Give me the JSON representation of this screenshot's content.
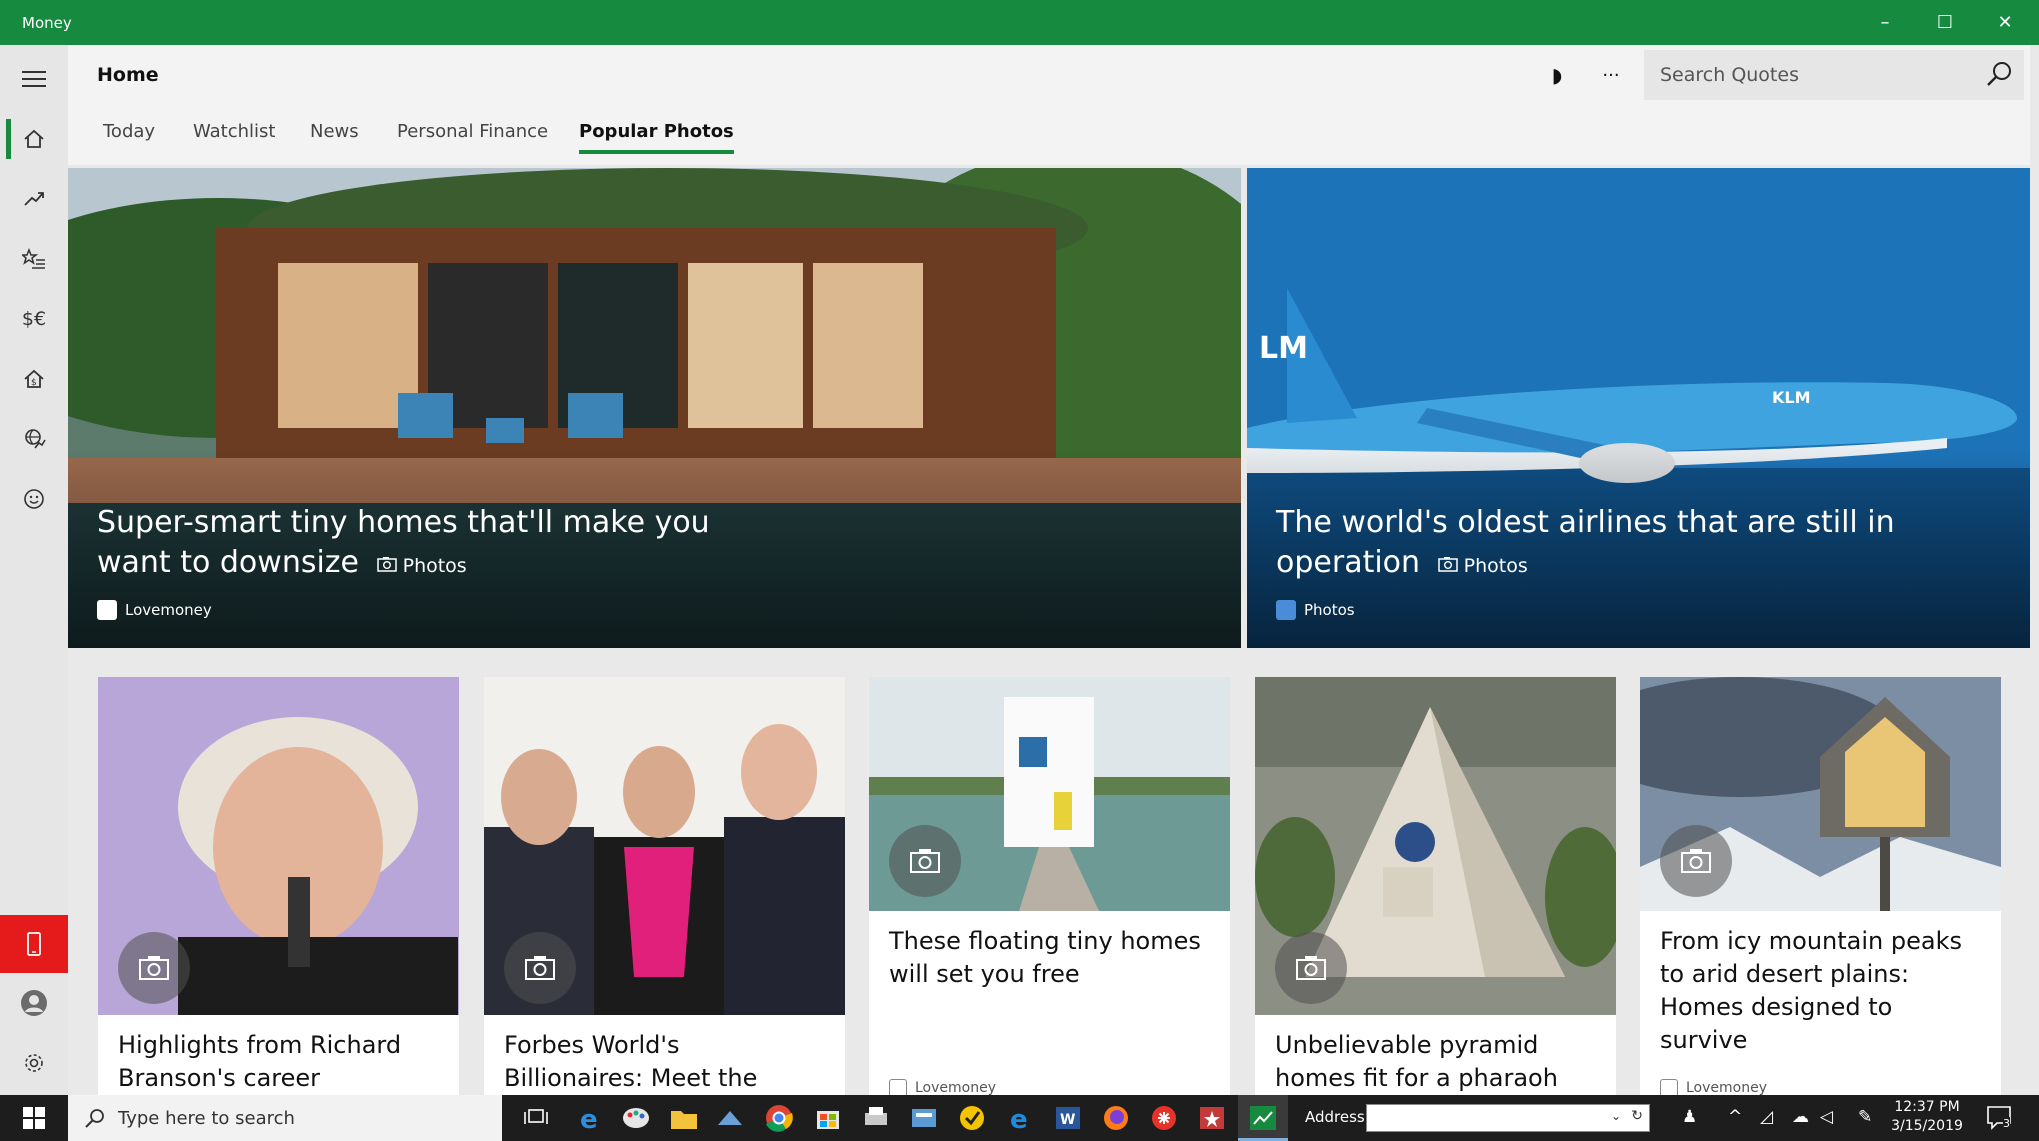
{
  "window": {
    "title": "Money",
    "controls": [
      "–",
      "☐",
      "✕"
    ]
  },
  "header": {
    "title": "Home",
    "theme_icon": "◗",
    "more_icon": "···",
    "search_placeholder": "Search Quotes"
  },
  "tabs": [
    {
      "label": "Today",
      "active": false
    },
    {
      "label": "Watchlist",
      "active": false
    },
    {
      "label": "News",
      "active": false
    },
    {
      "label": "Personal Finance",
      "active": false
    },
    {
      "label": "Popular Photos",
      "active": true
    }
  ],
  "hero": [
    {
      "title": "Super-smart tiny homes that'll make you want to downsize",
      "tag": "Photos",
      "source": "Lovemoney"
    },
    {
      "title": "The world's oldest airlines that are still in operation",
      "tag": "Photos",
      "source": "Photos"
    }
  ],
  "cards": [
    {
      "title": "Highlights from Richard Branson's career",
      "source": ""
    },
    {
      "title": "Forbes World's Billionaires: Meet the richest people of",
      "source": ""
    },
    {
      "title": "These floating tiny homes will set you free",
      "source": "Lovemoney"
    },
    {
      "title": "Unbelievable pyramid homes fit for a pharaoh",
      "source": ""
    },
    {
      "title": "From icy mountain peaks to arid desert plains: Homes designed to survive",
      "source": "Lovemoney"
    }
  ],
  "taskbar": {
    "search_text": "Type here to search",
    "address_label": "Address",
    "time": "12:37 PM",
    "date": "3/15/2019",
    "notification_count": "3"
  },
  "colors": {
    "accent": "#168a3e",
    "alert_red": "#e51a1a",
    "taskbar": "#1d1d1d"
  }
}
